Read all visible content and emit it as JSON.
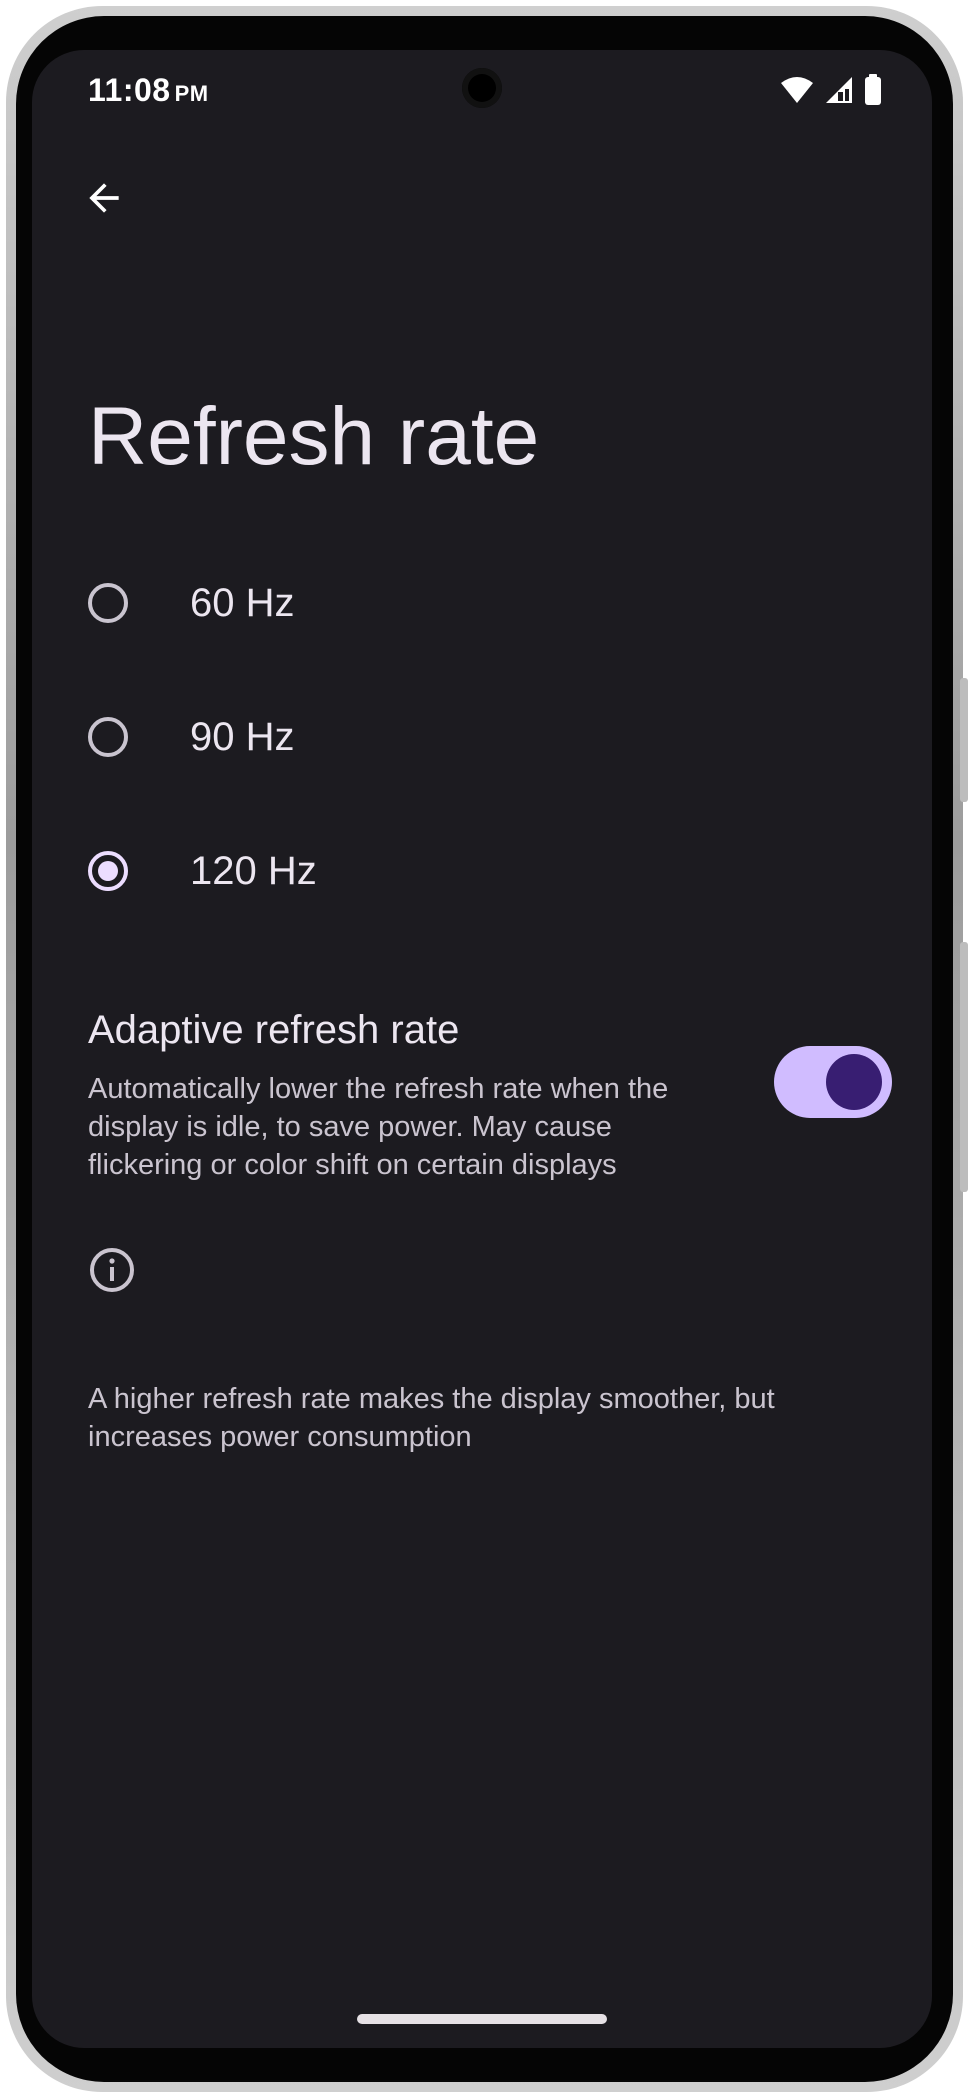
{
  "status_bar": {
    "time": "11:08",
    "ampm": "PM",
    "icons": [
      "wifi-icon",
      "signal-icon",
      "battery-icon"
    ]
  },
  "header": {
    "back_icon": "arrow-back-icon",
    "title": "Refresh rate"
  },
  "options": [
    {
      "label": "60 Hz",
      "selected": false
    },
    {
      "label": "90 Hz",
      "selected": false
    },
    {
      "label": "120 Hz",
      "selected": true
    }
  ],
  "adaptive": {
    "title": "Adaptive refresh rate",
    "description": "Automatically lower the refresh rate when the display is idle, to save power. May cause flickering or color shift on certain displays",
    "enabled": true
  },
  "footer": {
    "icon": "info-icon",
    "text": "A higher refresh rate makes the display smoother, but increases power consumption"
  },
  "colors": {
    "background": "#1c1b20",
    "accent": "#d0bcff",
    "switch_thumb": "#381e72",
    "text_primary": "#ece6f0",
    "text_secondary": "#cac4cf"
  }
}
